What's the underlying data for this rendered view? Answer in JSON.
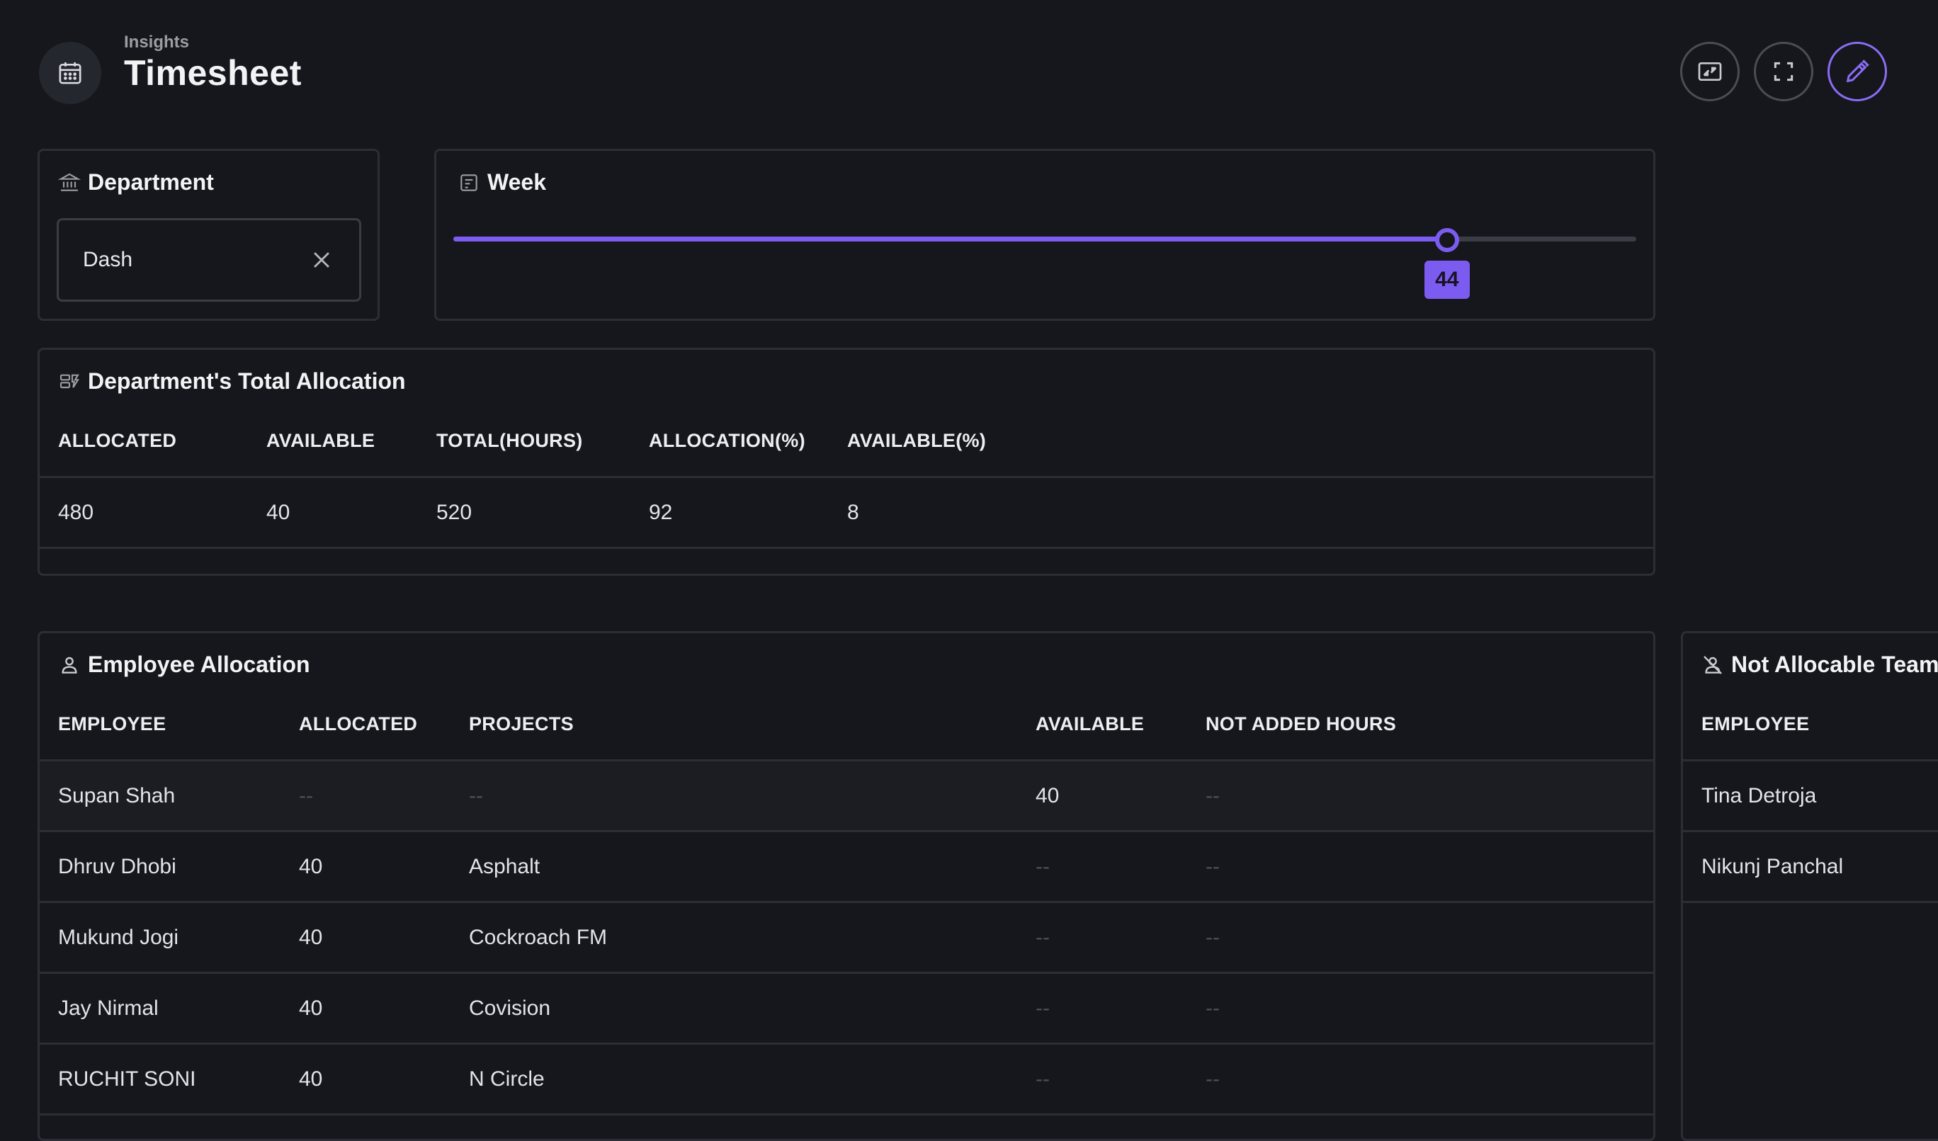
{
  "header": {
    "breadcrumb": "Insights",
    "title": "Timesheet"
  },
  "department_filter": {
    "title": "Department",
    "selected": "Dash"
  },
  "week_filter": {
    "title": "Week",
    "value": "44",
    "fill_fraction": 0.84
  },
  "total_allocation": {
    "title": "Department's Total Allocation",
    "columns": [
      "ALLOCATED",
      "AVAILABLE",
      "TOTAL(HOURS)",
      "ALLOCATION(%)",
      "AVAILABLE(%)"
    ],
    "row": [
      "480",
      "40",
      "520",
      "92",
      "8"
    ]
  },
  "employee_allocation": {
    "title": "Employee Allocation",
    "columns": [
      "EMPLOYEE",
      "ALLOCATED",
      "PROJECTS",
      "AVAILABLE",
      "NOT ADDED HOURS"
    ],
    "rows": [
      {
        "employee": "Supan Shah",
        "allocated": "--",
        "projects": "--",
        "available": "40",
        "not_added": "--"
      },
      {
        "employee": "Dhruv Dhobi",
        "allocated": "40",
        "projects": "Asphalt",
        "available": "--",
        "not_added": "--"
      },
      {
        "employee": "Mukund Jogi",
        "allocated": "40",
        "projects": "Cockroach FM",
        "available": "--",
        "not_added": "--"
      },
      {
        "employee": "Jay Nirmal",
        "allocated": "40",
        "projects": "Covision",
        "available": "--",
        "not_added": "--"
      },
      {
        "employee": "RUCHIT SONI",
        "allocated": "40",
        "projects": "N Circle",
        "available": "--",
        "not_added": "--"
      }
    ]
  },
  "not_allocable": {
    "title": "Not Allocable Team",
    "columns": [
      "EMPLOYEE"
    ],
    "rows": [
      "Tina Detroja",
      "Nikunj Panchal"
    ]
  },
  "colors": {
    "accent": "#7c5cf0",
    "background": "#15171c",
    "border": "#2b2e35"
  }
}
